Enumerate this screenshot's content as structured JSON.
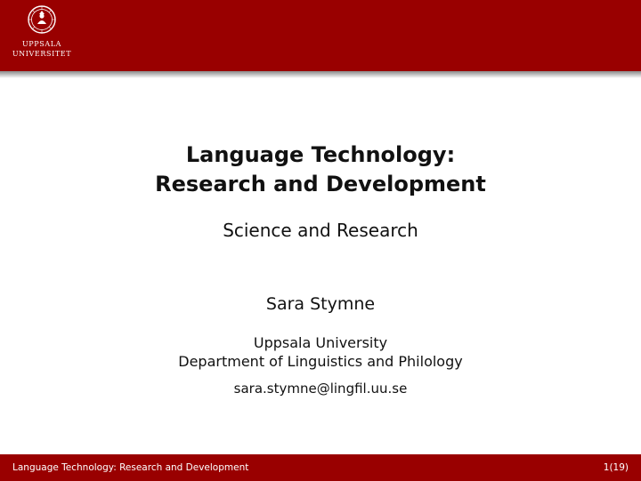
{
  "header": {
    "logo": {
      "icon": "uppsala-university-seal-icon",
      "line1": "UPPSALA",
      "line2": "UNIVERSITET"
    },
    "color": "#990000"
  },
  "slide": {
    "title_line1": "Language Technology:",
    "title_line2": "Research and Development",
    "subtitle": "Science and Research",
    "author": "Sara Stymne",
    "institute_line1": "Uppsala University",
    "institute_line2": "Department of Linguistics and Philology",
    "email": "sara.stymne@lingfil.uu.se"
  },
  "footer": {
    "title": "Language Technology: Research and Development",
    "page": "1(19)"
  }
}
